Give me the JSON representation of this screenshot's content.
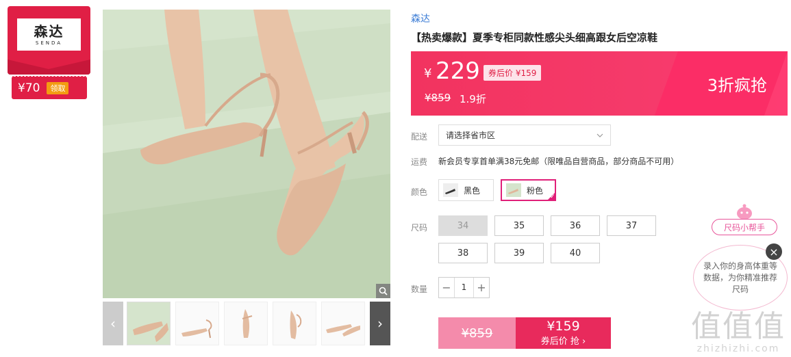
{
  "brand_badge": {
    "logo_cn": "森达",
    "logo_en": "SENDA",
    "coupon_amount": "¥70",
    "coupon_action": "领取"
  },
  "gallery": {
    "prev": "‹",
    "next": "›"
  },
  "product": {
    "brand": "森达",
    "title": "【热卖爆款】夏季专柜同款性感尖头细高跟女后空凉鞋"
  },
  "price": {
    "currency": "¥",
    "value": "229",
    "after_coupon": "券后价 ¥159",
    "original": "¥859",
    "discount": "1.9折",
    "promo": "3折疯抢"
  },
  "delivery": {
    "label": "配送",
    "placeholder": "请选择省市区"
  },
  "shipping": {
    "label": "运费",
    "text": "新会员专享首单满38元免邮（限唯品自营商品，部分商品不可用）"
  },
  "colors": {
    "label": "颜色",
    "options": [
      {
        "name": "黑色",
        "selected": false
      },
      {
        "name": "粉色",
        "selected": true
      }
    ]
  },
  "sizes": {
    "label": "尺码",
    "options": [
      {
        "value": "34",
        "available": false
      },
      {
        "value": "35",
        "available": true
      },
      {
        "value": "36",
        "available": true
      },
      {
        "value": "37",
        "available": true
      },
      {
        "value": "38",
        "available": true
      },
      {
        "value": "39",
        "available": true
      },
      {
        "value": "40",
        "available": true
      }
    ]
  },
  "quantity": {
    "label": "数量",
    "value": "1",
    "minus": "−",
    "plus": "+"
  },
  "buy": {
    "original": "¥859",
    "price": "¥159",
    "action": "券后价 抢 ›"
  },
  "size_helper": {
    "tag": "尺码小帮手",
    "bubble": "录入你的身高体重等数据，为你精准推荐尺码",
    "close": "×"
  },
  "watermark": {
    "big": "值值值",
    "small": "zhizhizhi.com"
  },
  "colors_palette": {
    "accent": "#e01f45",
    "pink": "#f2335f",
    "link": "#3a7bd5"
  }
}
